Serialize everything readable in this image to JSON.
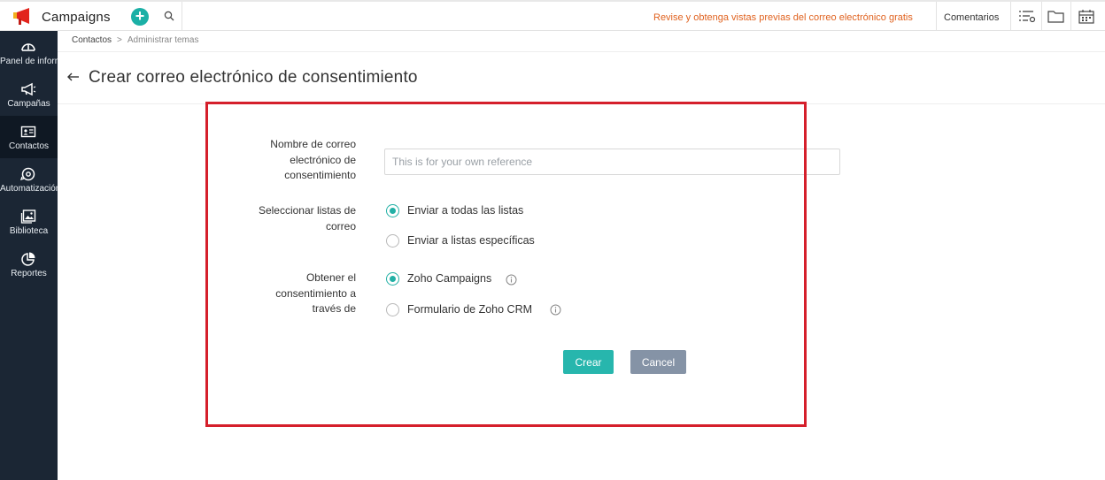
{
  "topbar": {
    "app_name": "Campaigns",
    "promo_link": "Revise y obtenga vistas previas del correo electrónico gratis",
    "feedback_link": "Comentarios",
    "icons": [
      "megaphone-logo",
      "add-icon",
      "search-icon",
      "list-settings-icon",
      "folder-icon",
      "calendar-icon"
    ],
    "colors": {
      "accent": "#1bb0a6",
      "promo": "#e0621f"
    }
  },
  "sidebar": {
    "items": [
      {
        "label": "Panel de información",
        "icon": "dashboard-icon",
        "active": false
      },
      {
        "label": "Campañas",
        "icon": "megaphone-icon",
        "active": false
      },
      {
        "label": "Contactos",
        "icon": "contact-card-icon",
        "active": true
      },
      {
        "label": "Automatización",
        "icon": "automation-icon",
        "active": false
      },
      {
        "label": "Biblioteca",
        "icon": "image-library-icon",
        "active": false
      },
      {
        "label": "Reportes",
        "icon": "pie-chart-icon",
        "active": false
      }
    ],
    "colors": {
      "background": "#1b2634",
      "active": "#0f1823"
    }
  },
  "breadcrumb": {
    "items": [
      "Contactos",
      "Administrar temas"
    ],
    "separator": ">"
  },
  "page": {
    "title": "Crear correo electrónico de consentimiento"
  },
  "form": {
    "name_field": {
      "label": "Nombre de correo electrónico de consentimiento",
      "label_lines": [
        "Nombre de correo",
        "electrónico de",
        "consentimiento"
      ],
      "placeholder": "This is for your own reference",
      "value": ""
    },
    "lists": {
      "label_lines": [
        "Seleccionar listas de",
        "correo"
      ],
      "options": [
        {
          "label": "Enviar a todas las listas",
          "selected": true
        },
        {
          "label": "Enviar a listas específicas",
          "selected": false
        }
      ]
    },
    "source": {
      "label_lines": [
        "Obtener el",
        "consentimiento a",
        "través de"
      ],
      "options": [
        {
          "label": "Zoho Campaigns",
          "selected": true,
          "info": true
        },
        {
          "label": "Formulario de Zoho CRM",
          "selected": false,
          "info": true
        }
      ]
    },
    "buttons": {
      "create": "Crear",
      "cancel": "Cancel"
    },
    "colors": {
      "primary": "#27b6ad",
      "secondary": "#8593a6",
      "highlight_border": "#d51f2b"
    }
  }
}
